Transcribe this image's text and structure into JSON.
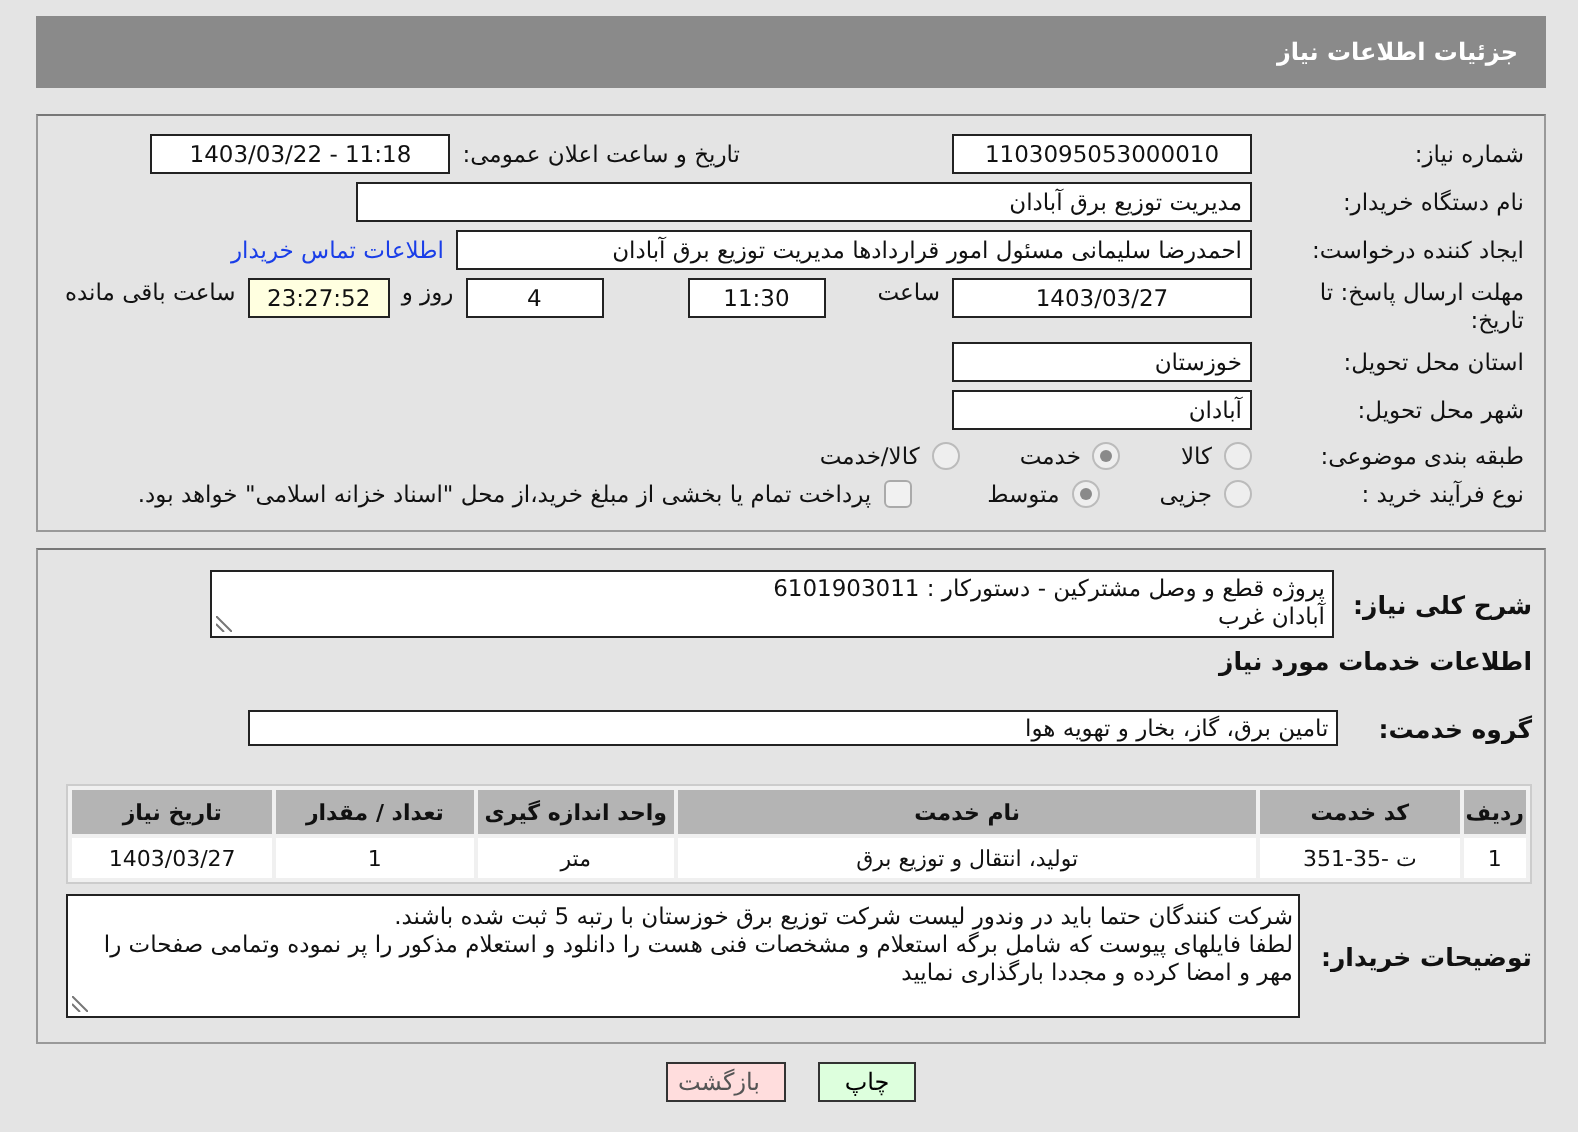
{
  "header": {
    "title": "جزئیات اطلاعات نیاز"
  },
  "need_number": {
    "label": "شماره نیاز:",
    "value": "1103095053000010"
  },
  "announce": {
    "label": "تاریخ و ساعت اعلان عمومی:",
    "value": "1403/03/22 - 11:18"
  },
  "buyer_org": {
    "label": "نام دستگاه خریدار:",
    "value": "مدیریت توزیع برق آبادان"
  },
  "requester": {
    "label": "ایجاد کننده درخواست:",
    "value": "احمدرضا سلیمانی مسئول امور قراردادها مدیریت توزیع برق آبادان",
    "link": "اطلاعات تماس خریدار"
  },
  "deadline": {
    "label": "مهلت ارسال پاسخ: تا تاریخ:",
    "date": "1403/03/27",
    "time_label": "ساعت",
    "time": "11:30",
    "days": "4",
    "days_label": "روز و",
    "remaining": "23:27:52",
    "remaining_label": "ساعت باقی مانده"
  },
  "province": {
    "label": "استان محل تحویل:",
    "value": "خوزستان"
  },
  "city": {
    "label": "شهر محل تحویل:",
    "value": "آبادان"
  },
  "category": {
    "label": "طبقه بندی موضوعی:",
    "options": [
      {
        "label": "کالا",
        "selected": false
      },
      {
        "label": "خدمت",
        "selected": true
      },
      {
        "label": "کالا/خدمت",
        "selected": false
      }
    ]
  },
  "process": {
    "label": "نوع فرآیند خرید :",
    "options": [
      {
        "label": "جزیی",
        "selected": false
      },
      {
        "label": "متوسط",
        "selected": true
      }
    ],
    "payment": {
      "label": "پرداخت تمام یا بخشی از مبلغ خرید،از محل \"اسناد خزانه اسلامی\" خواهد بود.",
      "checked": false
    }
  },
  "description": {
    "label": "شرح کلی نیاز:",
    "lines": [
      "پروژه قطع و وصل مشترکین - دستورکار : 6101903011",
      "آبادان غرب"
    ]
  },
  "services_title": "اطلاعات خدمات مورد نیاز",
  "service_group": {
    "label": "گروه خدمت:",
    "value": "تامین برق، گاز، بخار و تهویه هوا"
  },
  "table": {
    "columns": [
      "ردیف",
      "کد خدمت",
      "نام خدمت",
      "واحد اندازه گیری",
      "تعداد / مقدار",
      "تاریخ نیاز"
    ],
    "rows": [
      [
        "1",
        "ت -35-351",
        "تولید، انتقال و توزیع برق",
        "متر",
        "1",
        "1403/03/27"
      ]
    ]
  },
  "buyer_notes": {
    "label": "توضیحات خریدار:",
    "lines": [
      "شرکت کنندگان حتما باید در وندور لیست شرکت توزیع برق خوزستان با رتبه 5 ثبت شده باشند.",
      "لطفا فایلهای پیوست که شامل برگه استعلام و مشخصات فنی هست را دانلود و استعلام مذکور را پر نموده وتمامی صفحات را مهر و امضا کرده و مجددا بارگذاری نمایید"
    ]
  },
  "buttons": [
    {
      "label": "چاپ",
      "kind": "print"
    },
    {
      "label": "بازگشت",
      "kind": "back"
    }
  ]
}
